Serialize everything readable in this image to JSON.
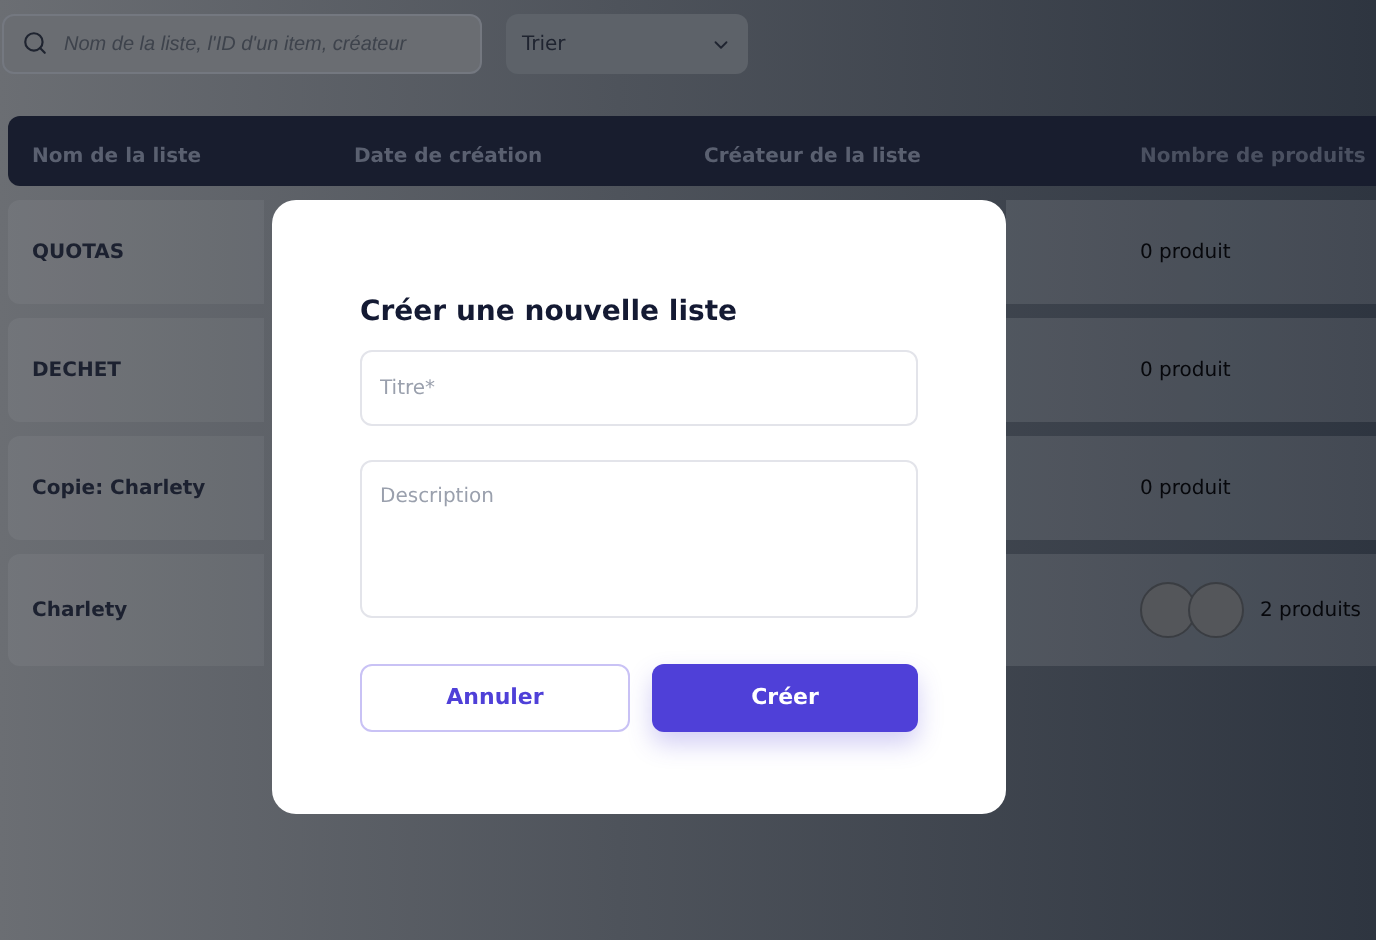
{
  "search": {
    "placeholder": "Nom de la liste, l'ID d'un item, créateur"
  },
  "sort": {
    "value": "Trier"
  },
  "table": {
    "columns": [
      "Nom de la liste",
      "Date de création",
      "Créateur de la liste",
      "Nombre de produits"
    ],
    "rows": [
      {
        "name": "QUOTAS",
        "products": "0 produit",
        "kind": "plain"
      },
      {
        "name": "DECHET",
        "products": "0 produit",
        "kind": "plain"
      },
      {
        "name": "Copie: Charlety",
        "products": "0 produit",
        "kind": "plain"
      },
      {
        "name": "Charlety",
        "products": "2 produits",
        "kind": "with_thumbnails"
      }
    ]
  },
  "dialog": {
    "title": "Créer une nouvelle liste",
    "fields": [
      {
        "kind": "input",
        "placeholder": "Titre*"
      },
      {
        "kind": "textarea",
        "placeholder": "Description"
      }
    ],
    "buttons": [
      {
        "label": "Annuler",
        "kind": "secondary"
      },
      {
        "label": "Créer",
        "kind": "primary"
      }
    ]
  }
}
